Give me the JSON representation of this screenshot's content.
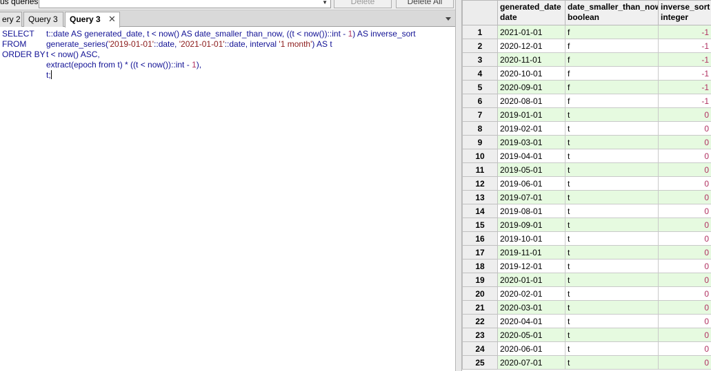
{
  "history": {
    "label": "us queries",
    "delete_label": "Delete",
    "delete_all_label": "Delete All"
  },
  "tabs": [
    {
      "label": "ery 2",
      "active": false
    },
    {
      "label": "Query 3",
      "active": false
    },
    {
      "label": "Query 3",
      "active": true,
      "close": "✕"
    }
  ],
  "editor": {
    "lines": [
      {
        "keyword": "SELECT",
        "code_parts": [
          {
            "t": "t::date AS generated_date, t < now() AS date_smaller_than_now, ((t < now())::int - ",
            "c": "plain"
          },
          {
            "t": "1",
            "c": "num"
          },
          {
            "t": ") AS inverse_sort",
            "c": "plain"
          }
        ]
      },
      {
        "keyword": "FROM",
        "code_parts": [
          {
            "t": "generate_series(",
            "c": "plain"
          },
          {
            "t": "'2019-01-01'",
            "c": "str"
          },
          {
            "t": "::date, ",
            "c": "plain"
          },
          {
            "t": "'2021-01-01'",
            "c": "str"
          },
          {
            "t": "::date, interval ",
            "c": "plain"
          },
          {
            "t": "'1 month'",
            "c": "str"
          },
          {
            "t": ") AS t",
            "c": "plain"
          }
        ]
      },
      {
        "keyword": "ORDER BY",
        "code_parts": [
          {
            "t": "t < now() ASC,",
            "c": "plain"
          }
        ]
      },
      {
        "keyword": "",
        "code_parts": [
          {
            "t": "extract(epoch from t) * ((t < now())::int - ",
            "c": "plain"
          },
          {
            "t": "1",
            "c": "num"
          },
          {
            "t": "),",
            "c": "plain"
          }
        ]
      },
      {
        "keyword": "",
        "code_parts": [
          {
            "t": "t;",
            "c": "plain"
          }
        ]
      }
    ]
  },
  "grid": {
    "columns": [
      {
        "name": "generated_date",
        "type": "date"
      },
      {
        "name": "date_smaller_than_now",
        "type": "boolean"
      },
      {
        "name": "inverse_sort",
        "type": "integer"
      }
    ],
    "rows": [
      [
        "1",
        "2021-01-01",
        "f",
        "-1"
      ],
      [
        "2",
        "2020-12-01",
        "f",
        "-1"
      ],
      [
        "3",
        "2020-11-01",
        "f",
        "-1"
      ],
      [
        "4",
        "2020-10-01",
        "f",
        "-1"
      ],
      [
        "5",
        "2020-09-01",
        "f",
        "-1"
      ],
      [
        "6",
        "2020-08-01",
        "f",
        "-1"
      ],
      [
        "7",
        "2019-01-01",
        "t",
        "0"
      ],
      [
        "8",
        "2019-02-01",
        "t",
        "0"
      ],
      [
        "9",
        "2019-03-01",
        "t",
        "0"
      ],
      [
        "10",
        "2019-04-01",
        "t",
        "0"
      ],
      [
        "11",
        "2019-05-01",
        "t",
        "0"
      ],
      [
        "12",
        "2019-06-01",
        "t",
        "0"
      ],
      [
        "13",
        "2019-07-01",
        "t",
        "0"
      ],
      [
        "14",
        "2019-08-01",
        "t",
        "0"
      ],
      [
        "15",
        "2019-09-01",
        "t",
        "0"
      ],
      [
        "16",
        "2019-10-01",
        "t",
        "0"
      ],
      [
        "17",
        "2019-11-01",
        "t",
        "0"
      ],
      [
        "18",
        "2019-12-01",
        "t",
        "0"
      ],
      [
        "19",
        "2020-01-01",
        "t",
        "0"
      ],
      [
        "20",
        "2020-02-01",
        "t",
        "0"
      ],
      [
        "21",
        "2020-03-01",
        "t",
        "0"
      ],
      [
        "22",
        "2020-04-01",
        "t",
        "0"
      ],
      [
        "23",
        "2020-05-01",
        "t",
        "0"
      ],
      [
        "24",
        "2020-06-01",
        "t",
        "0"
      ],
      [
        "25",
        "2020-07-01",
        "t",
        "0"
      ]
    ]
  },
  "colors": {
    "row_tint": "#e6fae0",
    "keyword": "#101094",
    "string": "#8b1a1a",
    "number": "#b03060"
  }
}
